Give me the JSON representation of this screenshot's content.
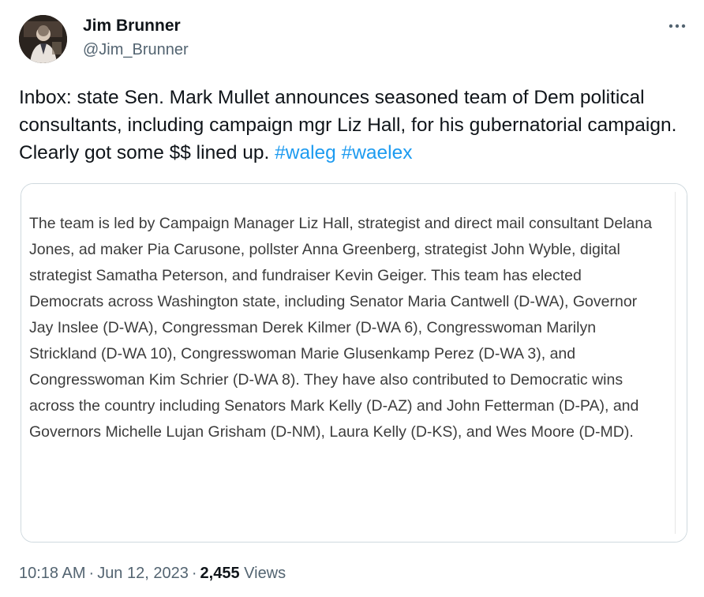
{
  "author": {
    "display_name": "Jim Brunner",
    "handle": "@Jim_Brunner",
    "avatar_icon": "profile-photo"
  },
  "tweet": {
    "text": "Inbox: state Sen. Mark Mullet announces seasoned team of Dem political consultants, including campaign mgr Liz Hall, for his gubernatorial campaign. Clearly got some $$ lined up.",
    "hashtags": [
      "#waleg",
      "#waelex"
    ]
  },
  "media": {
    "screenshot_text": "The team is led by Campaign Manager Liz Hall, strategist and direct mail consultant Delana Jones, ad maker Pia Carusone, pollster Anna Greenberg, strategist John Wyble, digital strategist Samatha Peterson, and fundraiser Kevin Geiger. This team has elected Democrats across Washington state, including Senator Maria Cantwell (D-WA), Governor Jay Inslee (D-WA), Congressman Derek Kilmer (D-WA 6), Congresswoman Marilyn Strickland (D-WA 10), Congresswoman Marie Glusenkamp Perez (D-WA 3), and Congresswoman Kim Schrier (D-WA 8). They have also contributed to Democratic wins across the country including Senators Mark Kelly (D-AZ) and John Fetterman (D-PA), and Governors Michelle Lujan Grisham (D-NM), Laura Kelly (D-KS), and Wes Moore (D-MD)."
  },
  "meta": {
    "time": "10:18 AM",
    "date": "Jun 12, 2023",
    "separator": "·",
    "views_count": "2,455",
    "views_label": "Views"
  },
  "icons": {
    "more": "more-horizontal-icon"
  },
  "colors": {
    "link": "#1d9bf0",
    "secondary_text": "#536471",
    "primary_text": "#0f1419",
    "card_border": "#cfd9de"
  }
}
